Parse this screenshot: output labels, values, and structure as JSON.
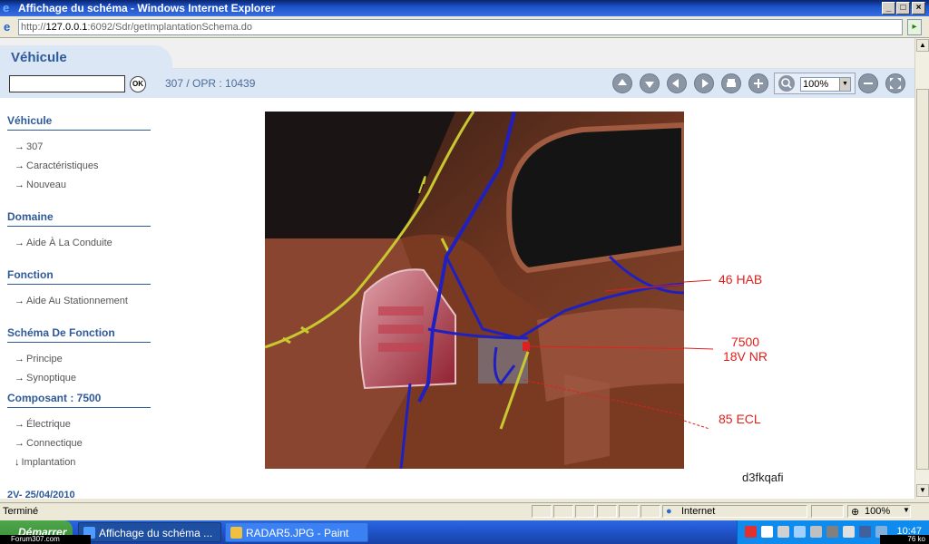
{
  "window": {
    "title": "Affichage du schéma - Windows Internet Explorer",
    "controls": [
      "_",
      "□",
      "×"
    ]
  },
  "address": {
    "prefix": "http://",
    "host": "127.0.0.1",
    "rest": ":6092/Sdr/getImplantationSchema.do"
  },
  "header": {
    "tab_label": "Véhicule",
    "ok_label": "OK",
    "breadcrumb": "307  /  OPR : 10439",
    "zoom_value": "100%"
  },
  "sidebar": {
    "sections": [
      {
        "title": "Véhicule",
        "items": [
          "307",
          "Caractéristiques",
          "Nouveau"
        ]
      },
      {
        "title": "Domaine",
        "items": [
          "Aide À La Conduite"
        ]
      },
      {
        "title": "Fonction",
        "items": [
          "Aide Au Stationnement"
        ]
      },
      {
        "title": "Schéma De Fonction",
        "items": [
          "Principe",
          "Synoptique"
        ]
      },
      {
        "title": "Composant : 7500",
        "items": [
          "Électrique",
          "Connectique",
          "Implantation"
        ]
      }
    ],
    "arrows": [
      "→",
      "↓"
    ],
    "date_footer": "2V- 25/04/2010"
  },
  "diagram": {
    "callouts": {
      "hab": "46 HAB",
      "comp_line1": "7500",
      "comp_line2": "18V NR",
      "ecl": "85 ECL"
    },
    "ref_code": "d3fkqafi"
  },
  "status": {
    "text": "Terminé",
    "zone": "Internet",
    "zoom": "100%"
  },
  "taskbar": {
    "start": "Démarrer",
    "tasks": [
      "Affichage du schéma ...",
      "RADAR5.JPG - Paint"
    ],
    "clock": "10:47",
    "watermark": "Forum307.com",
    "size": "76 ko"
  },
  "colors": {
    "brand_blue": "#2e5a99",
    "toolbar_bg": "#dce7f6",
    "callout_red": "#e0201c",
    "wire_blue": "#2020c0",
    "wire_yellow": "#c8c830"
  }
}
